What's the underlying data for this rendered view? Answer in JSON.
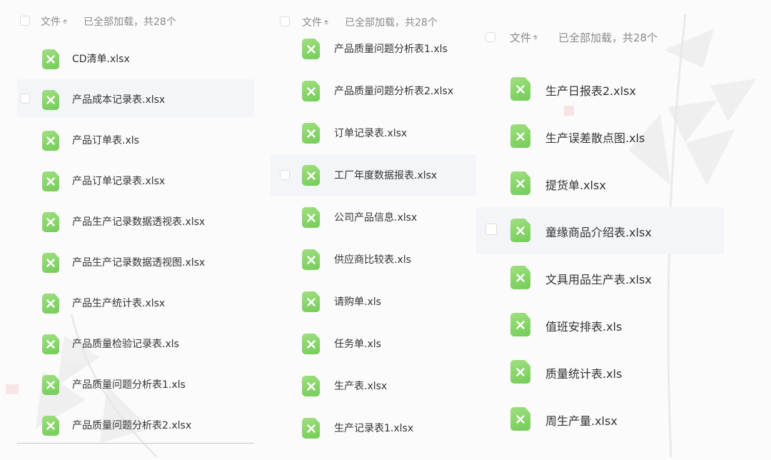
{
  "panels": [
    {
      "header": {
        "name_label": "文件",
        "status_text": "已全部加载，共28个"
      },
      "files": [
        "CD清单.xlsx",
        "产品成本记录表.xlsx",
        "产品订单表.xls",
        "产品订单记录表.xlsx",
        "产品生产记录数据透视表.xlsx",
        "产品生产记录数据透视图.xlsx",
        "产品生产统计表.xlsx",
        "产品质量检验记录表.xls",
        "产品质量问题分析表1.xls",
        "产品质量问题分析表2.xlsx"
      ],
      "highlighted_index": 1
    },
    {
      "header": {
        "name_label": "文件",
        "status_text": "已全部加载，共28个"
      },
      "files": [
        "产品质量问题分析表1.xls",
        "产品质量问题分析表2.xlsx",
        "订单记录表.xlsx",
        "工厂年度数据报表.xlsx",
        "公司产品信息.xlsx",
        "供应商比较表.xls",
        "请购单.xls",
        "任务单.xls",
        "生产表.xlsx",
        "生产记录表1.xlsx"
      ],
      "highlighted_index": 3
    },
    {
      "header": {
        "name_label": "文件",
        "status_text": "已全部加载，共28个"
      },
      "files": [
        "生产日报表2.xlsx",
        "生产误差散点图.xls",
        "提货单.xlsx",
        "童缘商品介绍表.xlsx",
        "文具用品生产表.xlsx",
        "值班安排表.xls",
        "质量统计表.xls",
        "周生产量.xlsx"
      ],
      "highlighted_index": 3
    }
  ],
  "icons": {
    "file_type": "excel-file-icon",
    "sort": "sort-icon"
  },
  "colors": {
    "excel_green": "#7ed162",
    "row_highlight": "#f3f5f8",
    "header_text": "#8a8a8a"
  }
}
